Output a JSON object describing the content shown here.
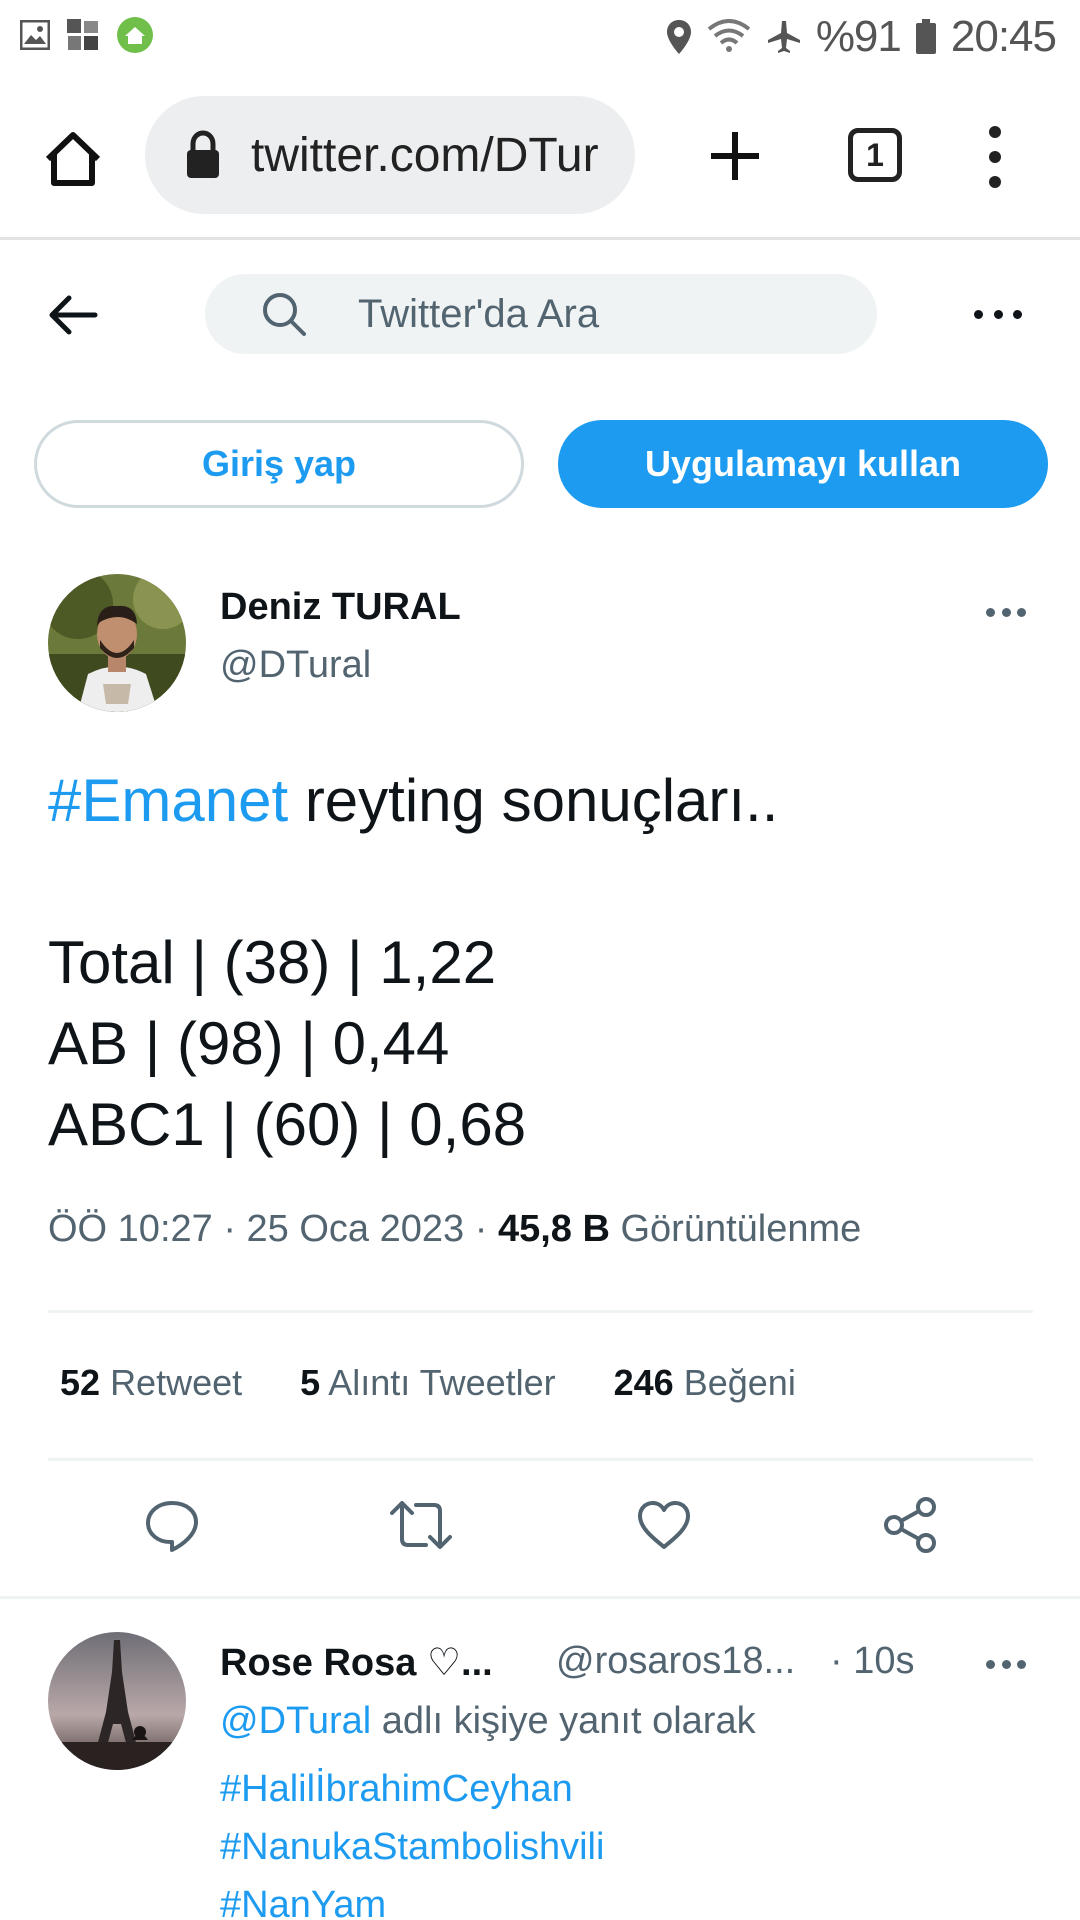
{
  "status_bar": {
    "battery": "%91",
    "time": "20:45",
    "left_icons": [
      "image-icon",
      "mosaic-app-icon",
      "home-app-icon"
    ],
    "right_icons": [
      "location-icon",
      "wifi-icon",
      "airplane-icon",
      "battery-icon"
    ]
  },
  "browser": {
    "url": "twitter.com/DTur",
    "tab_count": "1"
  },
  "header": {
    "search_placeholder": "Twitter'da Ara"
  },
  "auth": {
    "login_label": "Giriş yap",
    "app_label": "Uygulamayı kullan"
  },
  "tweet": {
    "author_name": "Deniz TURAL",
    "author_handle": "@DTural",
    "hashtag": "#Emanet",
    "text_rest": " reyting sonuçları..",
    "lines": [
      "Total | (38) | 1,22",
      "AB | (98) | 0,44",
      "ABC1 | (60) | 0,68"
    ],
    "time": "ÖÖ 10:27",
    "date": "25 Oca 2023",
    "views_count": "45,8 B",
    "views_label": "Görüntülenme",
    "stats": {
      "retweets": "52",
      "retweets_label": "Retweet",
      "quotes": "5",
      "quotes_label": "Alıntı Tweetler",
      "likes": "246",
      "likes_label": "Beğeni"
    }
  },
  "reply": {
    "name": "Rose Rosa ♡...",
    "handle": "@rosaros18...",
    "time": "· 10s",
    "mention": "@DTural",
    "reply_label": "adlı kişiye yanıt olarak",
    "hashtags": [
      "#HalilİbrahimCeyhan",
      "#NanukaStambolishvili",
      "#NanYam"
    ]
  },
  "colors": {
    "accent": "#1d9bf0",
    "text": "#0f1419",
    "secondary": "#536471"
  }
}
